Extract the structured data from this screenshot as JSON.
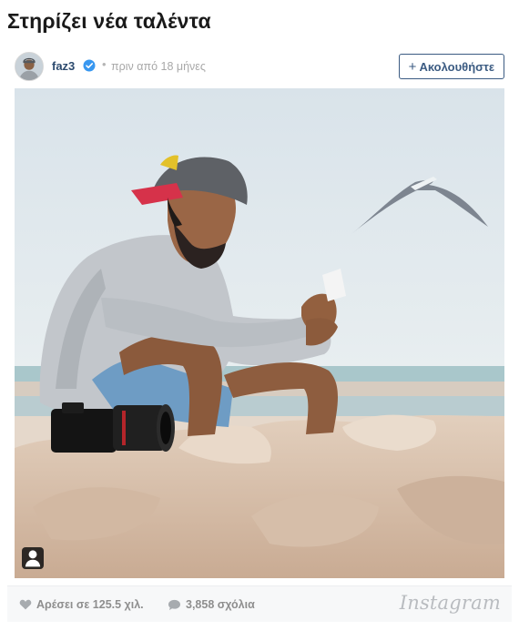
{
  "page": {
    "title": "Στηρίζει νέα ταλέντα"
  },
  "post": {
    "username": "faz3",
    "verified": true,
    "separator": "•",
    "timestamp": "πριν από 18 μήνες",
    "follow_label": "Ακολουθήστε",
    "follow_icon": "plus-icon",
    "likes": "Αρέσει σε 125.5 χιλ.",
    "comments": "3,858 σχόλια",
    "brand": "Instagram"
  },
  "colors": {
    "accent": "#3b5b82",
    "username": "#2c4a6e",
    "verified_badge": "#3897f0",
    "muted_text": "#a8a8a8",
    "footer_bg": "#f7f8f9"
  },
  "icons": {
    "verified": "verified-badge-icon",
    "like": "heart-icon",
    "comment": "speech-bubble-icon",
    "user_tag": "user-tag-icon"
  }
}
